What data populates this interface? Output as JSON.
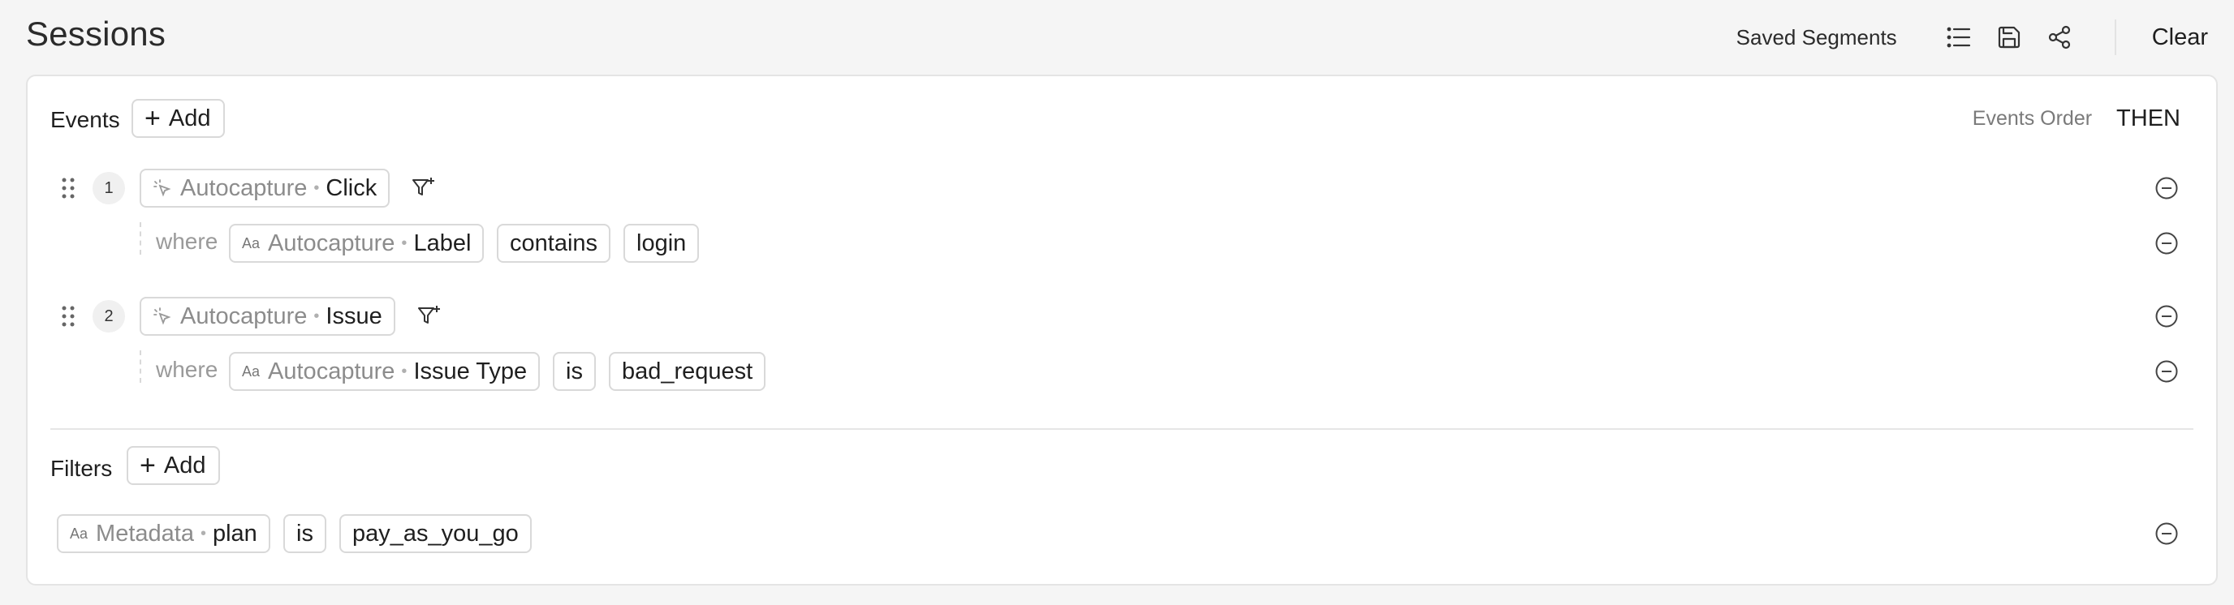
{
  "header": {
    "title": "Sessions",
    "saved_segments": "Saved Segments",
    "clear": "Clear",
    "icons": [
      "list-icon",
      "save-icon",
      "share-icon"
    ]
  },
  "events": {
    "label": "Events",
    "add_label": "Add",
    "order_label": "Events Order",
    "order_value": "THEN",
    "steps": [
      {
        "index": "1",
        "source": "Autocapture",
        "name": "Click",
        "where": "where",
        "filter": {
          "source": "Autocapture",
          "property": "Label",
          "operator": "contains",
          "value": "login"
        }
      },
      {
        "index": "2",
        "source": "Autocapture",
        "name": "Issue",
        "where": "where",
        "filter": {
          "source": "Autocapture",
          "property": "Issue Type",
          "operator": "is",
          "value": "bad_request"
        }
      }
    ]
  },
  "filters": {
    "label": "Filters",
    "add_label": "Add",
    "items": [
      {
        "source": "Metadata",
        "property": "plan",
        "operator": "is",
        "value": "pay_as_you_go"
      }
    ]
  },
  "colors": {
    "border": "#d9d9d9",
    "muted": "#8c8c8c",
    "text": "#1f1f1f",
    "background": "#f5f5f5"
  }
}
